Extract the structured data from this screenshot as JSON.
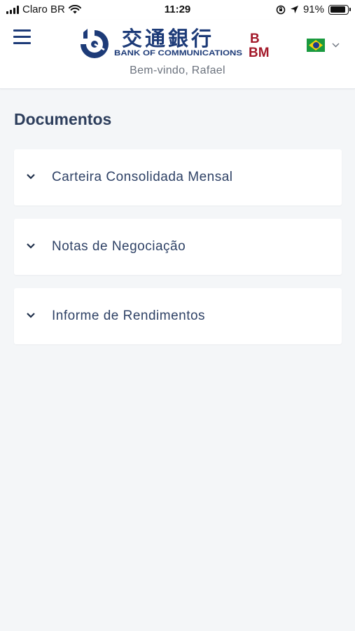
{
  "status_bar": {
    "carrier": "Claro BR",
    "time": "11:29",
    "battery_percent": "91%",
    "battery_level": 0.91,
    "icons": [
      "signal-icon",
      "wifi-icon",
      "orientation-lock-icon",
      "location-icon",
      "battery-icon"
    ]
  },
  "header": {
    "menu_icon": "hamburger-menu-icon",
    "logo": {
      "chinese_name": "交通銀行",
      "english_name": "BANK OF COMMUNICATIONS",
      "bbm_top": "B",
      "bbm_bottom": "BM"
    },
    "language": {
      "flag": "brazil-flag-icon",
      "dropdown_icon": "chevron-down-icon"
    },
    "welcome": "Bem-vindo, Rafael"
  },
  "main": {
    "title": "Documentos",
    "sections": [
      {
        "label": "Carteira Consolidada Mensal"
      },
      {
        "label": "Notas de Negociação"
      },
      {
        "label": "Informe de Rendimentos"
      }
    ]
  },
  "colors": {
    "brand_blue": "#1d3b78",
    "brand_red": "#a3192a",
    "background": "#f4f6f8",
    "card": "#ffffff",
    "text": "#2f4266"
  }
}
